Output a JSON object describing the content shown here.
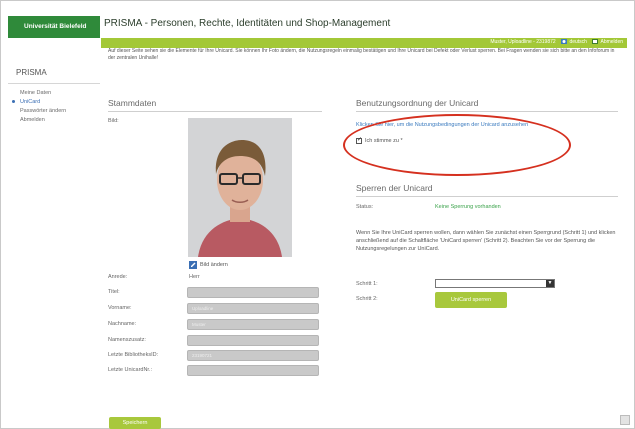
{
  "header": {
    "logo_text": "Universität Bielefeld",
    "app_title": "PRISMA - Personen, Rechte, Identitäten und Shop-Management",
    "userbar": {
      "user_info": "Muster, Uploadline - 2319872",
      "language_label": "deutsch",
      "logout_label": "Abmelden"
    }
  },
  "sidebar": {
    "title": "PRISMA",
    "items": [
      {
        "label": "Meine Daten"
      },
      {
        "label": "UniCard"
      },
      {
        "label": "Passwörter ändern"
      },
      {
        "label": "Abmelden"
      }
    ]
  },
  "intro": "Auf dieser Seite sehen sie die Elemente für Ihre Unicard. Sie können Ihr Foto ändern, die Nutzungsregeln einmalig bestätigen und Ihre Unicard bei Defekt oder Verlust sperren. Bei Fragen wenden sie sich bitte an den Infoforum in der zentralen Unihalle!",
  "stammdaten": {
    "heading": "Stammdaten",
    "bild_label": "Bild:",
    "bild_aendern": "Bild ändern",
    "fields": [
      {
        "label": "Anrede:",
        "value": "Herr",
        "type": "text"
      },
      {
        "label": "Titel:",
        "value": "",
        "type": "input"
      },
      {
        "label": "Vorname:",
        "value": "Uploadline",
        "type": "input"
      },
      {
        "label": "Nachname:",
        "value": "Muster",
        "type": "input"
      },
      {
        "label": "Namenszusatz:",
        "value": "",
        "type": "input"
      },
      {
        "label": "Letzte BibliotheksID:",
        "value": "23190721",
        "type": "input"
      },
      {
        "label": "Letzte UnicardNr.:",
        "value": "",
        "type": "input"
      }
    ],
    "save_label": "Speichern"
  },
  "nutzungsordnung": {
    "heading": "Benutzungsordnung der Unicard",
    "link_text": "Klicken Sie hier, um die Nutzungsbedingungen der Unicard anzusehen",
    "checkbox_label": "Ich stimme zu *",
    "checked": true
  },
  "sperren": {
    "heading": "Sperren der Unicard",
    "status_label": "Status:",
    "status_value": "Keine Sperrung vorhanden",
    "instructions": "Wenn Sie Ihre UniCard sperren wollen, dann wählen Sie zunächst einen Sperrgrund (Schritt 1) und klicken anschließend auf die Schaltfläche 'UniCard sperren' (Schritt 2). Beachten Sie vor der Sperrung die Nutzungsregelungen zur UniCard.",
    "step1_label": "Schritt 1:",
    "step2_label": "Schritt 2:",
    "select_value": "",
    "button_label": "UniCard sperren"
  },
  "colors": {
    "brand_green": "#2f8a3a",
    "accent_green": "#a3c837",
    "annotation_red": "#d5301f",
    "link_blue": "#3b7bbf"
  }
}
